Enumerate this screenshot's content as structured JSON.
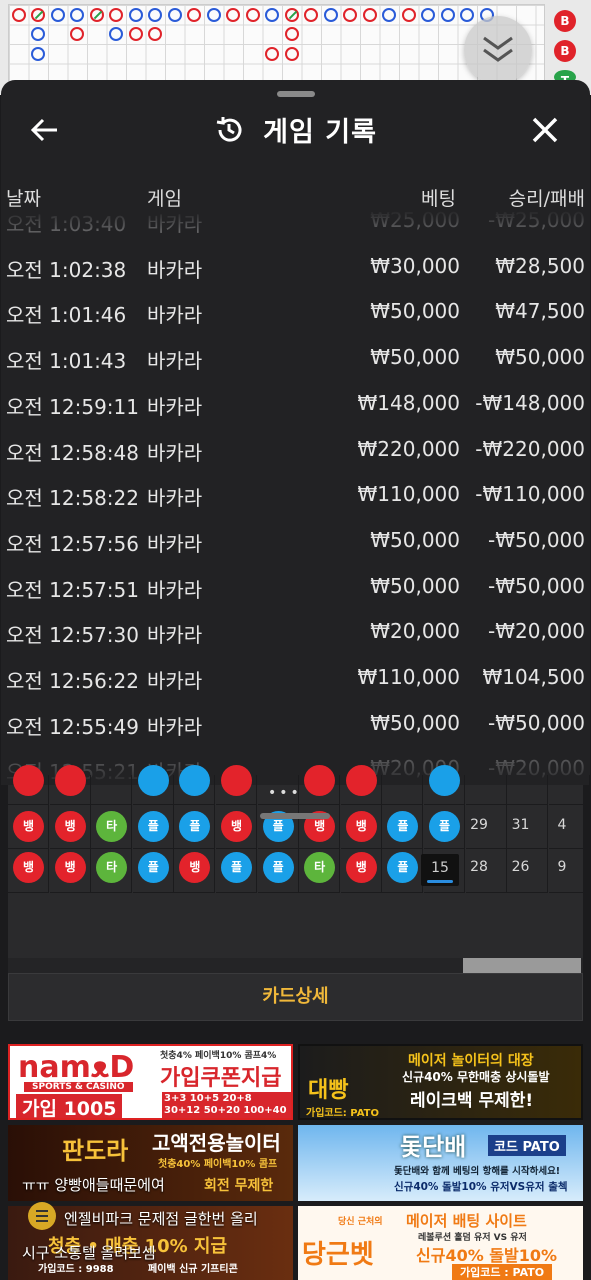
{
  "top_road": {
    "side_badges": [
      "B",
      "B",
      "T"
    ],
    "side_colors": [
      "#e0232a",
      "#e0232a",
      "#29a34a"
    ]
  },
  "modal": {
    "title": "게임 기록",
    "columns": {
      "date": "날짜",
      "game": "게임",
      "bet": "베팅",
      "result": "승리/패배"
    },
    "rows": [
      {
        "date": "오전 1:03:40",
        "game": "바카라",
        "bet": "₩25,000",
        "result": "-₩25,000",
        "partial": true
      },
      {
        "date": "오전 1:02:38",
        "game": "바카라",
        "bet": "₩30,000",
        "result": "₩28,500"
      },
      {
        "date": "오전 1:01:46",
        "game": "바카라",
        "bet": "₩50,000",
        "result": "₩47,500"
      },
      {
        "date": "오전 1:01:43",
        "game": "바카라",
        "bet": "₩50,000",
        "result": "₩50,000"
      },
      {
        "date": "오전 12:59:11",
        "game": "바카라",
        "bet": "₩148,000",
        "result": "-₩148,000"
      },
      {
        "date": "오전 12:58:48",
        "game": "바카라",
        "bet": "₩220,000",
        "result": "-₩220,000"
      },
      {
        "date": "오전 12:58:22",
        "game": "바카라",
        "bet": "₩110,000",
        "result": "-₩110,000"
      },
      {
        "date": "오전 12:57:56",
        "game": "바카라",
        "bet": "₩50,000",
        "result": "-₩50,000"
      },
      {
        "date": "오전 12:57:51",
        "game": "바카라",
        "bet": "₩50,000",
        "result": "-₩50,000"
      },
      {
        "date": "오전 12:57:30",
        "game": "바카라",
        "bet": "₩20,000",
        "result": "-₩20,000"
      },
      {
        "date": "오전 12:56:22",
        "game": "바카라",
        "bet": "₩110,000",
        "result": "₩104,500"
      },
      {
        "date": "오전 12:55:49",
        "game": "바카라",
        "bet": "₩50,000",
        "result": "-₩50,000"
      },
      {
        "date": "오전 12:55:21",
        "game": "바카라",
        "bet": "₩20,000",
        "result": "-₩20,000",
        "partial": true
      }
    ]
  },
  "bead_road": {
    "row1": [
      "뱅",
      "뱅",
      "타",
      "플",
      "플",
      "뱅",
      "플",
      "뱅",
      "뱅",
      "플",
      "플"
    ],
    "row2": [
      "뱅",
      "뱅",
      "타",
      "플",
      "뱅",
      "플",
      "플",
      "타",
      "뱅",
      "플"
    ],
    "current_round": "15",
    "stats_row1": [
      "29",
      "31",
      "4"
    ],
    "stats_row2": [
      "28",
      "26",
      "9"
    ],
    "colors": {
      "뱅": "#e3232b",
      "플": "#1aa0e8",
      "타": "#5db53c"
    }
  },
  "card_detail_label": "카드상세",
  "banners": [
    {
      "name": "named",
      "line1": "namᴥD",
      "line2": "SPORTS & CASINO",
      "line3": "가입 1005",
      "line4": "첫충4% 페이백10% 콤프4%",
      "line5": "가입쿠폰지급",
      "line6": "3+3 10+5 20+8 30+12 50+20 100+40"
    },
    {
      "name": "daebbang",
      "line1": "대빵",
      "line2": "메이저 놀이터의 대장",
      "line3": "신규40% 무한매충 상시돌발",
      "line4": "레이크백 무제한!",
      "line5": "가입코드: PATO"
    },
    {
      "name": "pandora",
      "line1": "판도라",
      "line2": "고액전용놀이터",
      "line3": "첫충40% 페이백10% 콤프",
      "line4": "회전 무제한"
    },
    {
      "name": "dotdanbae",
      "line1": "돛단배",
      "line2": "코드 PATO",
      "line3": "돛단배와 함께 베팅의 항해를 시작하세요!",
      "line4": "신규40% 돌발10% 유저VS유저 출첵"
    },
    {
      "name": "angel",
      "line1": "청충 • 매충 10% 지급",
      "line2": "가입코드 : 9988",
      "line3": "페이백 신규 기프티콘"
    },
    {
      "name": "danggeun",
      "line1": "당근벳",
      "line2": "당신 근처의",
      "line3": "메이저 배팅 사이트",
      "line4": "레볼루션 홀덤 유저 VS 유저",
      "line5": "신규40% 돌발10%",
      "line6": "가입코드 : PATO"
    }
  ],
  "chat": {
    "messages": [
      "ㅠㅠ 양빵애들때문에여",
      "엔젤비파크 문제점 글한번 올리",
      "시구 소통텔 올려보셈"
    ]
  }
}
